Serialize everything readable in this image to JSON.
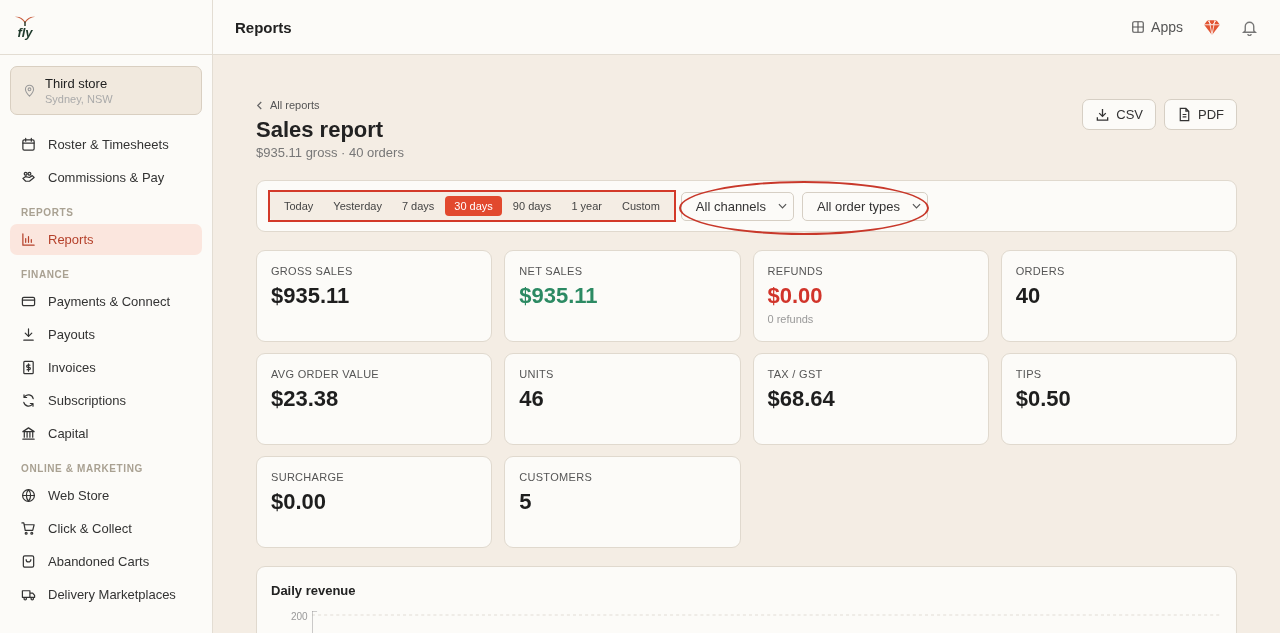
{
  "logo": {
    "text": "fly"
  },
  "store": {
    "name": "Third store",
    "location": "Sydney, NSW"
  },
  "sidebar": {
    "sections": [
      {
        "items": [
          {
            "label": "Roster & Timesheets",
            "selected": false
          },
          {
            "label": "Commissions & Pay",
            "selected": false
          }
        ]
      },
      {
        "heading": "REPORTS",
        "items": [
          {
            "label": "Reports",
            "selected": true
          }
        ]
      },
      {
        "heading": "FINANCE",
        "items": [
          {
            "label": "Payments & Connect",
            "selected": false
          },
          {
            "label": "Payouts",
            "selected": false
          },
          {
            "label": "Invoices",
            "selected": false
          },
          {
            "label": "Subscriptions",
            "selected": false
          },
          {
            "label": "Capital",
            "selected": false
          }
        ]
      },
      {
        "heading": "ONLINE & MARKETING",
        "items": [
          {
            "label": "Web Store",
            "selected": false
          },
          {
            "label": "Click & Collect",
            "selected": false
          },
          {
            "label": "Abandoned Carts",
            "selected": false
          },
          {
            "label": "Delivery Marketplaces",
            "selected": false
          }
        ]
      }
    ]
  },
  "header": {
    "title": "Reports",
    "apps": "Apps"
  },
  "breadcrumb": "All reports",
  "title": "Sales report",
  "subtitle": "$935.11 gross · 40 orders",
  "exports": [
    {
      "label": "CSV"
    },
    {
      "label": "PDF"
    }
  ],
  "ranges": [
    {
      "label": "Today",
      "selected": false
    },
    {
      "label": "Yesterday",
      "selected": false
    },
    {
      "label": "7 days",
      "selected": false
    },
    {
      "label": "30 days",
      "selected": true
    },
    {
      "label": "90 days",
      "selected": false
    },
    {
      "label": "1 year",
      "selected": false
    },
    {
      "label": "Custom",
      "selected": false
    }
  ],
  "filters": [
    {
      "value": "All channels"
    },
    {
      "value": "All order types"
    }
  ],
  "highlights": {
    "ranges_boxed": true,
    "filters_circled": true
  },
  "metrics": [
    {
      "label": "GROSS SALES",
      "value": "$935.11",
      "color": "#1e1e1e"
    },
    {
      "label": "NET SALES",
      "value": "$935.11",
      "color": "#2c8a63"
    },
    {
      "label": "REFUNDS",
      "value": "$0.00",
      "color": "#d1342a",
      "note": "0 refunds"
    },
    {
      "label": "ORDERS",
      "value": "40",
      "color": "#1e1e1e"
    },
    {
      "label": "AVG ORDER VALUE",
      "value": "$23.38",
      "color": "#1e1e1e"
    },
    {
      "label": "UNITS",
      "value": "46",
      "color": "#1e1e1e"
    },
    {
      "label": "TAX / GST",
      "value": "$68.64",
      "color": "#1e1e1e"
    },
    {
      "label": "TIPS",
      "value": "$0.50",
      "color": "#1e1e1e"
    },
    {
      "label": "SURCHARGE",
      "value": "$0.00",
      "color": "#1e1e1e"
    },
    {
      "label": "CUSTOMERS",
      "value": "5",
      "color": "#1e1e1e"
    }
  ],
  "chart": {
    "title": "Daily revenue",
    "tick": "200"
  }
}
